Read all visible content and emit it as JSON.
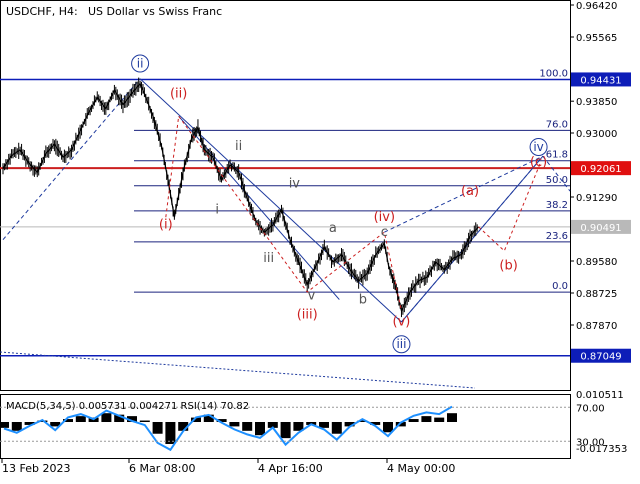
{
  "header": {
    "symbol": "USDCHF, H4:",
    "description": "US Dollar vs Swiss Franc"
  },
  "colors": {
    "background": "#ffffff",
    "candles": "#000000",
    "blue_wave": "#1e3a9e",
    "red_wave": "#cc1f1f",
    "grey_wave": "#555555",
    "fib_lines": "#1a237e",
    "price_tag_blue": "#0d1db8",
    "price_tag_red": "#e01010",
    "price_tag_grey": "#b9b9b9",
    "rsi": "#1e90ff",
    "macd": "#000000"
  },
  "chart_data": [
    {
      "type": "line",
      "title": "",
      "y_axis": {
        "ticks": [
          "0.96420",
          "0.95565",
          "0.93850",
          "0.93000",
          "0.91290",
          "0.89580",
          "0.88725",
          "0.87870"
        ],
        "ylim": [
          0.868,
          0.9642
        ]
      },
      "x_axis": {
        "ticks": [
          "13 Feb 2023",
          "6 Mar 08:00",
          "4 Apr 16:00",
          "4 May 00:00"
        ]
      },
      "series": [
        {
          "name": "",
          "points": [
            {
              "t": 0,
              "v": 0.9205
            },
            {
              "t": 4,
              "v": 0.924
            },
            {
              "t": 8,
              "v": 0.9255
            },
            {
              "t": 12,
              "v": 0.922
            },
            {
              "t": 16,
              "v": 0.9195
            },
            {
              "t": 20,
              "v": 0.9245
            },
            {
              "t": 24,
              "v": 0.927
            },
            {
              "t": 28,
              "v": 0.9235
            },
            {
              "t": 32,
              "v": 0.9255
            },
            {
              "t": 36,
              "v": 0.9305
            },
            {
              "t": 40,
              "v": 0.9355
            },
            {
              "t": 44,
              "v": 0.9395
            },
            {
              "t": 48,
              "v": 0.9365
            },
            {
              "t": 52,
              "v": 0.9415
            },
            {
              "t": 56,
              "v": 0.9375
            },
            {
              "t": 60,
              "v": 0.9405
            },
            {
              "t": 64,
              "v": 0.9432
            },
            {
              "t": 66,
              "v": 0.9405
            },
            {
              "t": 70,
              "v": 0.9345
            },
            {
              "t": 74,
              "v": 0.9265
            },
            {
              "t": 77,
              "v": 0.9175
            },
            {
              "t": 80,
              "v": 0.9075
            },
            {
              "t": 84,
              "v": 0.9195
            },
            {
              "t": 88,
              "v": 0.9285
            },
            {
              "t": 91,
              "v": 0.9315
            },
            {
              "t": 94,
              "v": 0.9255
            },
            {
              "t": 98,
              "v": 0.9235
            },
            {
              "t": 102,
              "v": 0.9175
            },
            {
              "t": 106,
              "v": 0.9215
            },
            {
              "t": 110,
              "v": 0.9195
            },
            {
              "t": 114,
              "v": 0.9125
            },
            {
              "t": 118,
              "v": 0.9065
            },
            {
              "t": 122,
              "v": 0.9035
            },
            {
              "t": 126,
              "v": 0.9055
            },
            {
              "t": 130,
              "v": 0.9095
            },
            {
              "t": 134,
              "v": 0.9015
            },
            {
              "t": 138,
              "v": 0.8955
            },
            {
              "t": 142,
              "v": 0.8895
            },
            {
              "t": 146,
              "v": 0.8945
            },
            {
              "t": 150,
              "v": 0.8995
            },
            {
              "t": 154,
              "v": 0.8955
            },
            {
              "t": 158,
              "v": 0.8975
            },
            {
              "t": 162,
              "v": 0.8935
            },
            {
              "t": 166,
              "v": 0.8905
            },
            {
              "t": 170,
              "v": 0.8925
            },
            {
              "t": 174,
              "v": 0.8975
            },
            {
              "t": 178,
              "v": 0.9005
            },
            {
              "t": 180,
              "v": 0.8945
            },
            {
              "t": 183,
              "v": 0.8895
            },
            {
              "t": 186,
              "v": 0.8825
            },
            {
              "t": 190,
              "v": 0.8875
            },
            {
              "t": 194,
              "v": 0.8905
            },
            {
              "t": 198,
              "v": 0.8915
            },
            {
              "t": 202,
              "v": 0.8955
            },
            {
              "t": 206,
              "v": 0.8935
            },
            {
              "t": 210,
              "v": 0.8965
            },
            {
              "t": 214,
              "v": 0.8975
            },
            {
              "t": 218,
              "v": 0.9025
            },
            {
              "t": 222,
              "v": 0.9049
            }
          ]
        }
      ],
      "levels": [
        {
          "label": "0.94431",
          "value": 0.94431,
          "style": "blue"
        },
        {
          "label": "0.92061",
          "value": 0.92061,
          "style": "red"
        },
        {
          "label": "0.90491",
          "value": 0.90491,
          "style": "grey"
        },
        {
          "label": "0.87049",
          "value": 0.87049,
          "style": "blue"
        }
      ],
      "fibonacci": [
        {
          "label": "100.0",
          "value": 0.94431
        },
        {
          "label": "76.0",
          "value": 0.9307
        },
        {
          "label": "61.8",
          "value": 0.9226
        },
        {
          "label": "50.0",
          "value": 0.9159
        },
        {
          "label": "38.2",
          "value": 0.9092
        },
        {
          "label": "23.6",
          "value": 0.9009
        },
        {
          "label": "0.0",
          "value": 0.8875
        }
      ],
      "wave_labels": [
        {
          "text": "ii",
          "t": 64,
          "v": 0.9475,
          "group": "blue",
          "circled": true
        },
        {
          "text": "iii",
          "t": 186,
          "v": 0.8725,
          "group": "blue",
          "circled": true
        },
        {
          "text": "iv",
          "t": 250,
          "v": 0.9252,
          "group": "blue",
          "circled": true
        },
        {
          "text": "(ii)",
          "t": 82,
          "v": 0.9395,
          "group": "red"
        },
        {
          "text": "(i)",
          "t": 76,
          "v": 0.9045,
          "group": "red"
        },
        {
          "text": "(iii)",
          "t": 142,
          "v": 0.8805,
          "group": "red"
        },
        {
          "text": "(iv)",
          "t": 178,
          "v": 0.9065,
          "group": "red"
        },
        {
          "text": "(v)",
          "t": 186,
          "v": 0.8785,
          "group": "red"
        },
        {
          "text": "(a)",
          "t": 218,
          "v": 0.9135,
          "group": "red"
        },
        {
          "text": "(b)",
          "t": 236,
          "v": 0.8935,
          "group": "red"
        },
        {
          "text": "(c)",
          "t": 250,
          "v": 0.9212,
          "group": "red"
        },
        {
          "text": "ii",
          "t": 110,
          "v": 0.9255,
          "group": "grey"
        },
        {
          "text": "i",
          "t": 100,
          "v": 0.9085,
          "group": "grey"
        },
        {
          "text": "iii",
          "t": 124,
          "v": 0.8955,
          "group": "grey"
        },
        {
          "text": "iv",
          "t": 136,
          "v": 0.9155,
          "group": "grey"
        },
        {
          "text": "v",
          "t": 144,
          "v": 0.8855,
          "group": "grey"
        },
        {
          "text": "a",
          "t": 154,
          "v": 0.9035,
          "group": "grey"
        },
        {
          "text": "b",
          "t": 168,
          "v": 0.8845,
          "group": "grey"
        },
        {
          "text": "c",
          "t": 178,
          "v": 0.9025,
          "group": "grey"
        }
      ],
      "forecast_path": [
        {
          "t": 222,
          "v": 0.9049
        },
        {
          "t": 234,
          "v": 0.8985
        },
        {
          "t": 251,
          "v": 0.9222
        }
      ]
    },
    {
      "type": "line",
      "title": "MACD(5,34,5) 0.005731 0.004271 RSI(14) 70.82",
      "y_axis": {
        "ticks": [
          "0.010511",
          "70.00",
          "30.00",
          "-0.017353"
        ],
        "ylim": [
          -0.017353,
          0.010511
        ]
      },
      "series": [
        {
          "name": "",
          "values": [
            -0.004,
            -0.006,
            -0.002,
            0.001,
            -0.003,
            0.002,
            0.004,
            0.003,
            0.006,
            0.005,
            0.004,
            0.001,
            -0.008,
            -0.015,
            -0.006,
            0.003,
            0.005,
            0.002,
            -0.003,
            -0.006,
            -0.009,
            -0.004,
            -0.011,
            -0.006,
            -0.002,
            -0.004,
            -0.008,
            -0.003,
            0.001,
            -0.002,
            -0.007,
            -0.003,
            0.002,
            0.004,
            0.003,
            0.006
          ]
        },
        {
          "name": "",
          "values": [
            45,
            40,
            48,
            55,
            43,
            58,
            62,
            56,
            66,
            60,
            54,
            49,
            28,
            20,
            42,
            58,
            61,
            52,
            44,
            38,
            34,
            46,
            26,
            40,
            50,
            44,
            32,
            47,
            56,
            48,
            36,
            52,
            60,
            64,
            62,
            70.82
          ]
        }
      ]
    }
  ]
}
